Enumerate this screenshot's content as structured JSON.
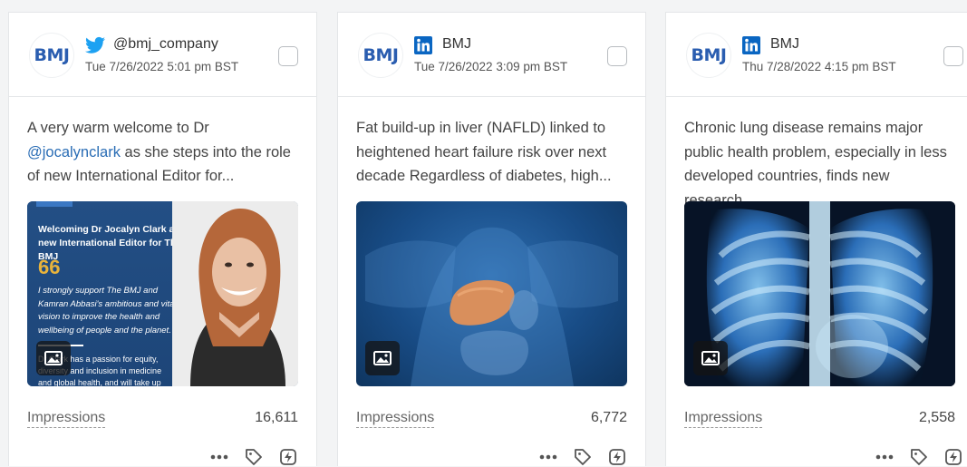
{
  "cards": [
    {
      "network": "twitter",
      "avatar_text": "BMJ",
      "handle": "@bmj_company",
      "date": "Tue 7/26/2022 5:01 pm BST",
      "text_before": "A very warm welcome to Dr ",
      "mention": "@jocalynclark",
      "text_after": " as she steps into the role of new International Editor for...",
      "media": {
        "headline": "Welcoming Dr Jocalyn Clark as new International Editor for The BMJ",
        "quote_mark": "66",
        "quote": "I strongly support The BMJ and Kamran Abbasi's ambitious and vital vision to improve the health and wellbeing of people and the planet. \"",
        "small_text": "Dr Clark has a passion for equity, diversity and inclusion in medicine and global health, and will take up"
      },
      "impressions_label": "Impressions",
      "impressions_value": "16,611"
    },
    {
      "network": "linkedin",
      "avatar_text": "BMJ",
      "handle": "BMJ",
      "date": "Tue 7/26/2022 3:09 pm BST",
      "text": "Fat build-up in liver (NAFLD) linked to heightened heart failure risk over next decade Regardless of diabetes, high...",
      "impressions_label": "Impressions",
      "impressions_value": "6,772"
    },
    {
      "network": "linkedin",
      "avatar_text": "BMJ",
      "handle": "BMJ",
      "date": "Thu 7/28/2022 4:15 pm BST",
      "text": "Chronic lung disease remains major public health problem, especially in less developed countries, finds new research...",
      "impressions_label": "Impressions",
      "impressions_value": "2,558"
    }
  ],
  "colors": {
    "twitter": "#1da1f2",
    "linkedin": "#0a66c2",
    "brand": "#2a5db0",
    "mention": "#2a6db5"
  },
  "icons": [
    "twitter-icon",
    "linkedin-icon",
    "image-icon",
    "more-icon",
    "tag-icon",
    "boost-icon"
  ]
}
